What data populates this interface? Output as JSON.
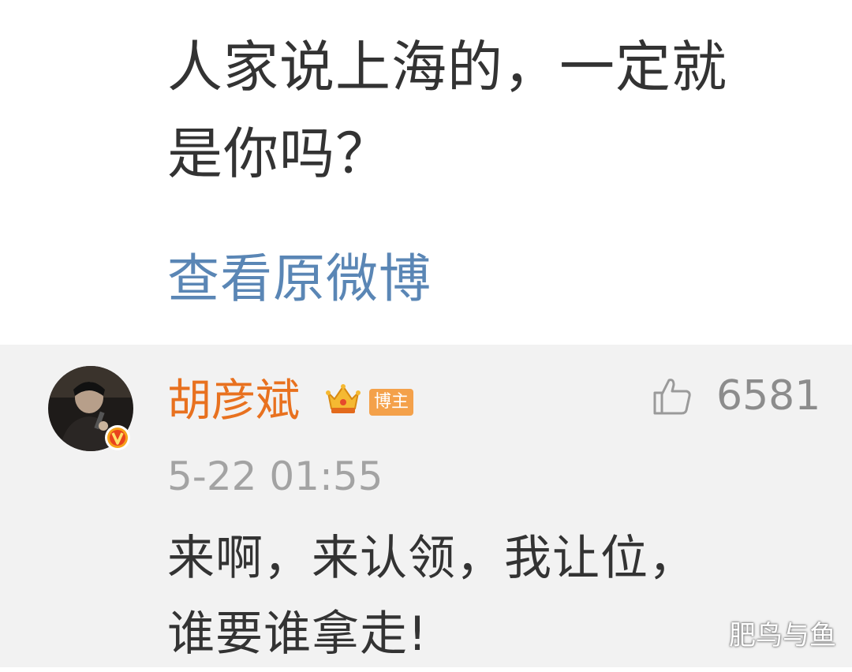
{
  "post": {
    "text_line1": "人家说上海的，一定就",
    "text_line2": "是你吗？",
    "view_original": "查看原微博"
  },
  "comment": {
    "username": "胡彦斌",
    "author_badge": "博主",
    "like_count": "6581",
    "timestamp": "5-22 01:55",
    "text_line1": "来啊，来认领，我让位，",
    "text_line2": "谁要谁拿走!"
  },
  "watermark": "肥鸟与鱼",
  "icons": {
    "avatar": "avatar-photo",
    "verified": "verified-v-icon",
    "crown": "crown-icon",
    "like": "thumbs-up-icon"
  },
  "colors": {
    "link": "#5a86b5",
    "username": "#e8711f",
    "badge": "#f4a14a",
    "comment_bg": "#f2f2f2",
    "muted": "#a3a3a3"
  }
}
